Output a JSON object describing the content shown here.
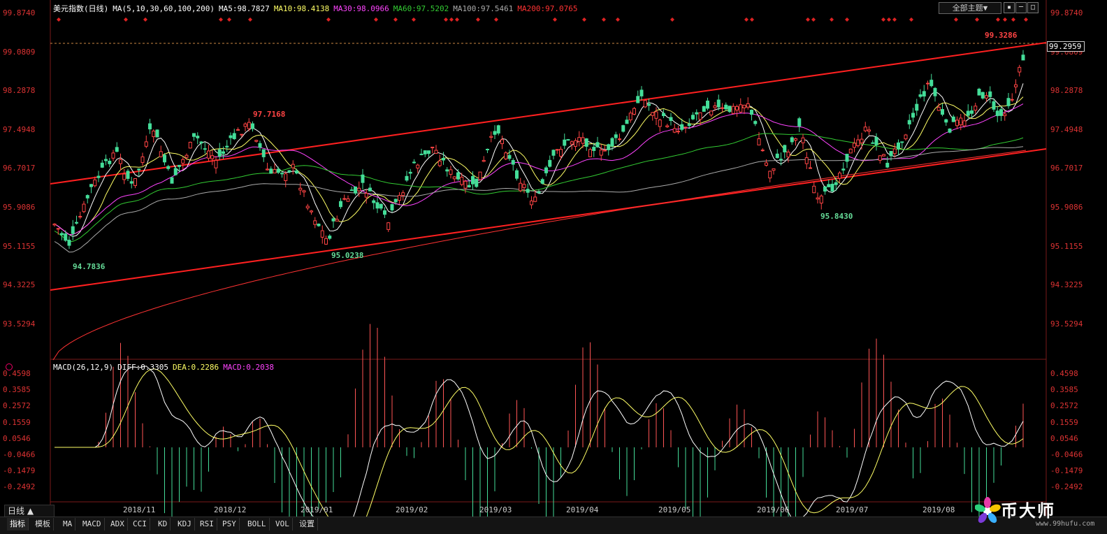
{
  "header": {
    "instrument": "美元指数(日线)",
    "ma_params": "MA(5,10,30,60,100,200)",
    "ma5": "MA5:98.7827",
    "ma10": "MA10:98.4138",
    "ma30": "MA30:98.0966",
    "ma60": "MA60:97.5202",
    "ma100": "MA100:97.5461",
    "ma200": "MA200:97.0765",
    "theme_button": "全部主题▼",
    "colors": {
      "ma5": "#ffffff",
      "ma10": "#ffff66",
      "ma30": "#ff44ff",
      "ma60": "#33cc33",
      "ma100": "#aaaaaa",
      "ma200": "#ff3333"
    }
  },
  "price_axis": {
    "left_labels": [
      "99.8740",
      "99.0809",
      "98.2878",
      "97.4948",
      "96.7017",
      "95.9086",
      "95.1155",
      "94.3225",
      "93.5294"
    ],
    "right_labels": [
      "99.8740",
      "99.0809",
      "98.2878",
      "97.4948",
      "96.7017",
      "95.9086",
      "95.1155",
      "94.3225",
      "93.5294"
    ],
    "current_price": "99.2959"
  },
  "annotations": {
    "high_label": "97.7168",
    "low1": "94.7836",
    "low2": "95.0238",
    "low3": "95.8430",
    "top_label": "99.3286"
  },
  "macd": {
    "header_params": "MACD(26,12,9)",
    "diff": "DIFF:0.3305",
    "dea": "DEA:0.2286",
    "macd": "MACD:0.2038",
    "left_labels": [
      "0.4598",
      "0.3585",
      "0.2572",
      "0.1559",
      "0.0546",
      "-0.0466",
      "-0.1479",
      "-0.2492"
    ],
    "right_labels": [
      "0.4598",
      "0.3585",
      "0.2572",
      "0.1559",
      "0.0546",
      "-0.0466",
      "-0.1479",
      "-0.2492"
    ]
  },
  "x_axis": {
    "labels": [
      "2018/11",
      "2018/12",
      "2019/01",
      "2019/02",
      "2019/03",
      "2019/04",
      "2019/05",
      "2019/06",
      "2019/07",
      "2019/08"
    ]
  },
  "bottom": {
    "period_button": "日线 ▲",
    "tabs": [
      "指标",
      "模板",
      "MA",
      "MACD",
      "ADX",
      "CCI",
      "KD",
      "KDJ",
      "RSI",
      "PSY",
      "BOLL",
      "VOL",
      "设置"
    ]
  },
  "logo": {
    "text": "币大师",
    "url": "www.99hufu.com"
  }
}
